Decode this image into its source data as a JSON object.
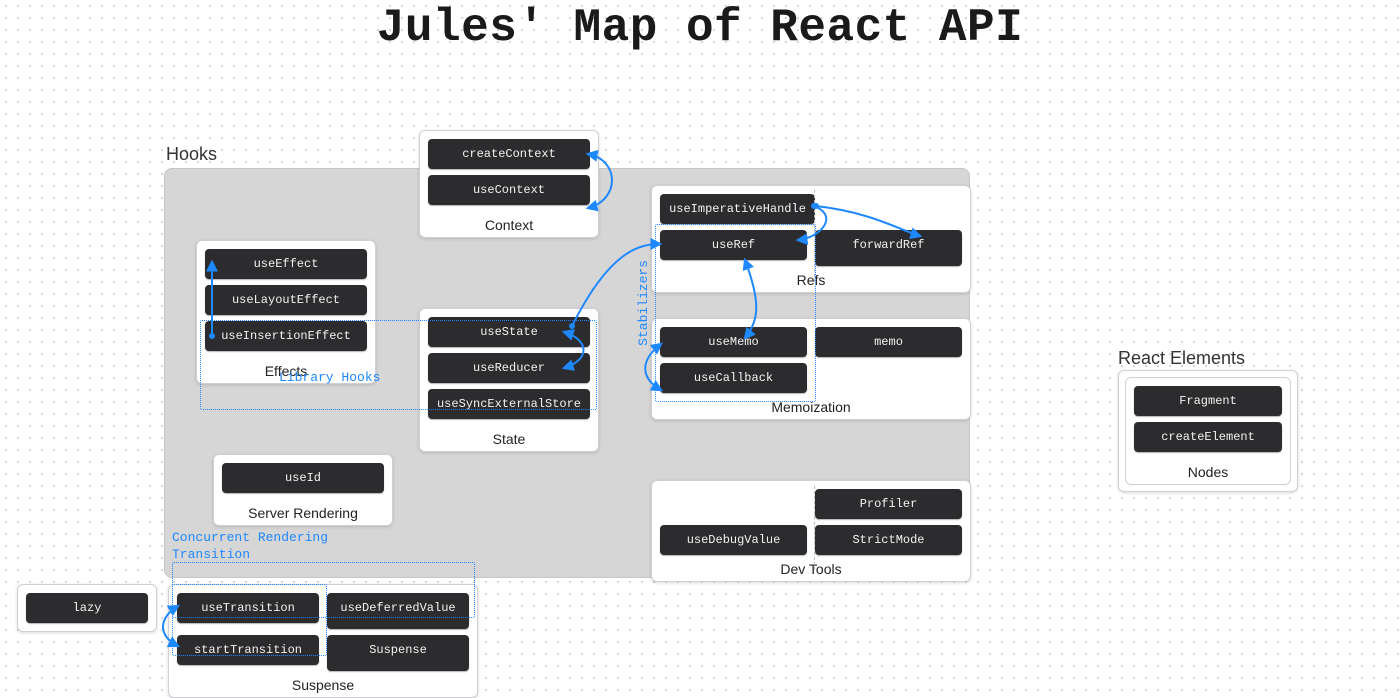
{
  "title": "Jules' Map of React API",
  "hooks_label": "Hooks",
  "react_elements_label": "React Elements",
  "groups": {
    "context": {
      "caption": "Context",
      "items": [
        "createContext",
        "useContext"
      ]
    },
    "effects": {
      "caption": "Effects",
      "items": [
        "useEffect",
        "useLayoutEffect",
        "useInsertionEffect"
      ]
    },
    "state": {
      "caption": "State",
      "items": [
        "useState",
        "useReducer",
        "useSyncExternalStore"
      ]
    },
    "refs": {
      "caption": "Refs",
      "items": [
        "useImperativeHandle",
        "useRef",
        "forwardRef"
      ]
    },
    "memo": {
      "caption": "Memoization",
      "items": [
        "useMemo",
        "useCallback",
        "memo"
      ]
    },
    "server": {
      "caption": "Server Rendering",
      "items": [
        "useId"
      ]
    },
    "devtools": {
      "caption": "Dev Tools",
      "items": [
        "useDebugValue",
        "Profiler",
        "StrictMode"
      ]
    },
    "suspense": {
      "caption": "Suspense",
      "items": [
        "useTransition",
        "useDeferredValue",
        "startTransition",
        "Suspense"
      ]
    },
    "nodes": {
      "caption": "Nodes",
      "items": [
        "Fragment",
        "createElement"
      ]
    }
  },
  "standalone": {
    "lazy": "lazy"
  },
  "annotations": {
    "library_hooks": "Library Hooks",
    "stabilizers": "Stabilizers",
    "concurrent": "Concurrent Rendering",
    "transition": "Transition"
  }
}
